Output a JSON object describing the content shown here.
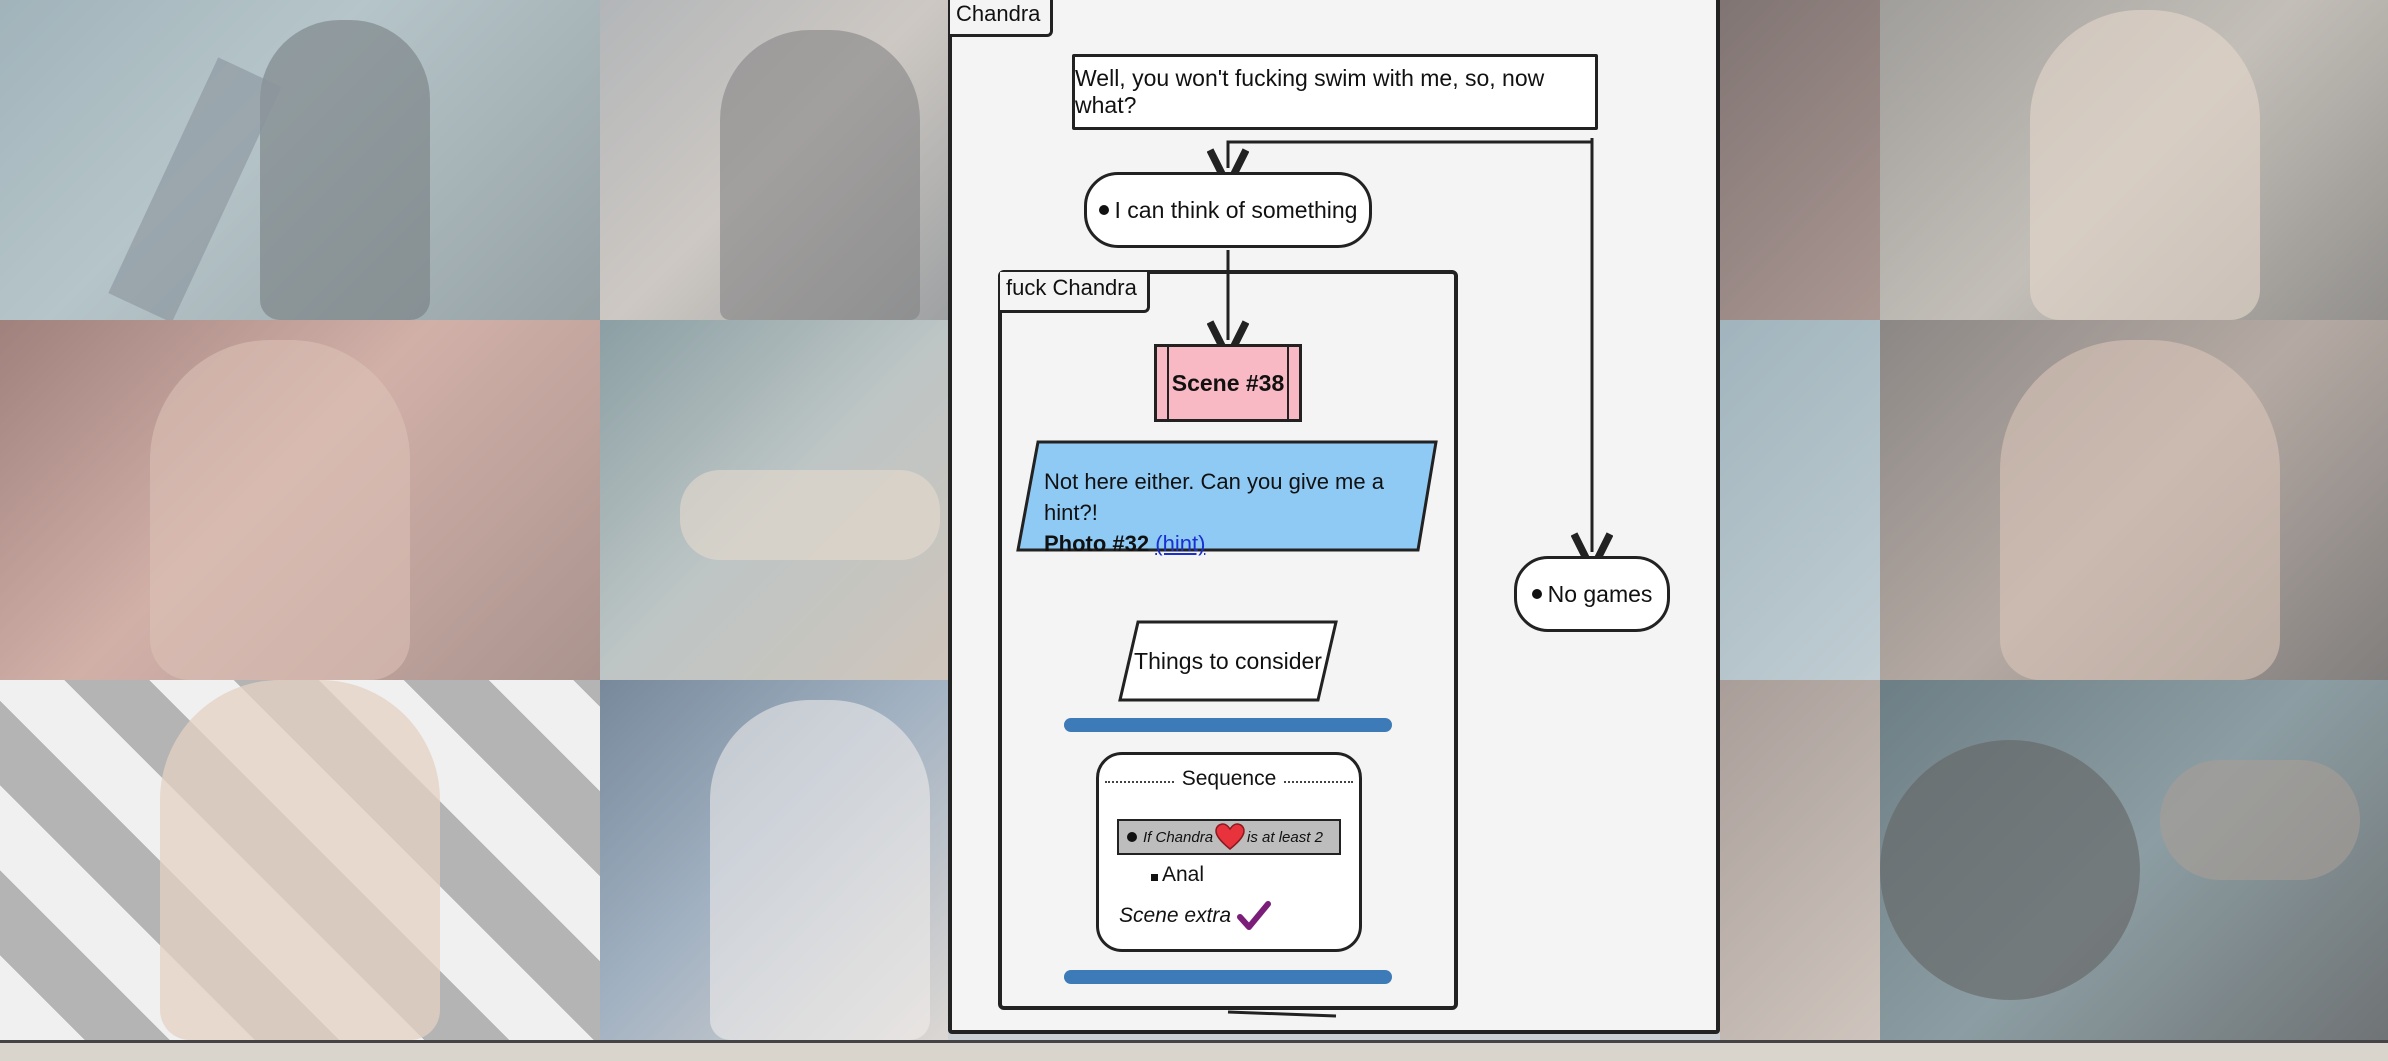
{
  "diagram": {
    "frame_title": "Chandra",
    "prompt_node": "Well, you won't fucking swim with me, so, now what?",
    "choice_1": "I can think of something",
    "choice_2": "No games",
    "group_title": "fuck Chandra",
    "scene": "Scene #38",
    "note": {
      "line1": "Not here either. Can you give me a hint?!",
      "photo": "Photo #32",
      "hint_link": "(hint)"
    },
    "things": "Things to consider",
    "sequence": {
      "title": "Sequence",
      "condition_prefix": "If Chandra",
      "condition_suffix": "is at least 2",
      "item": "Anal",
      "extra": "Scene extra"
    }
  },
  "colors": {
    "scene_fill": "#f8b8c4",
    "note_fill": "#8fcaf5",
    "bar": "#3c7ab8",
    "heart": "#e8323c",
    "check": "#7a1e7a"
  },
  "icons": [
    "heart-icon",
    "checkmark-icon"
  ]
}
